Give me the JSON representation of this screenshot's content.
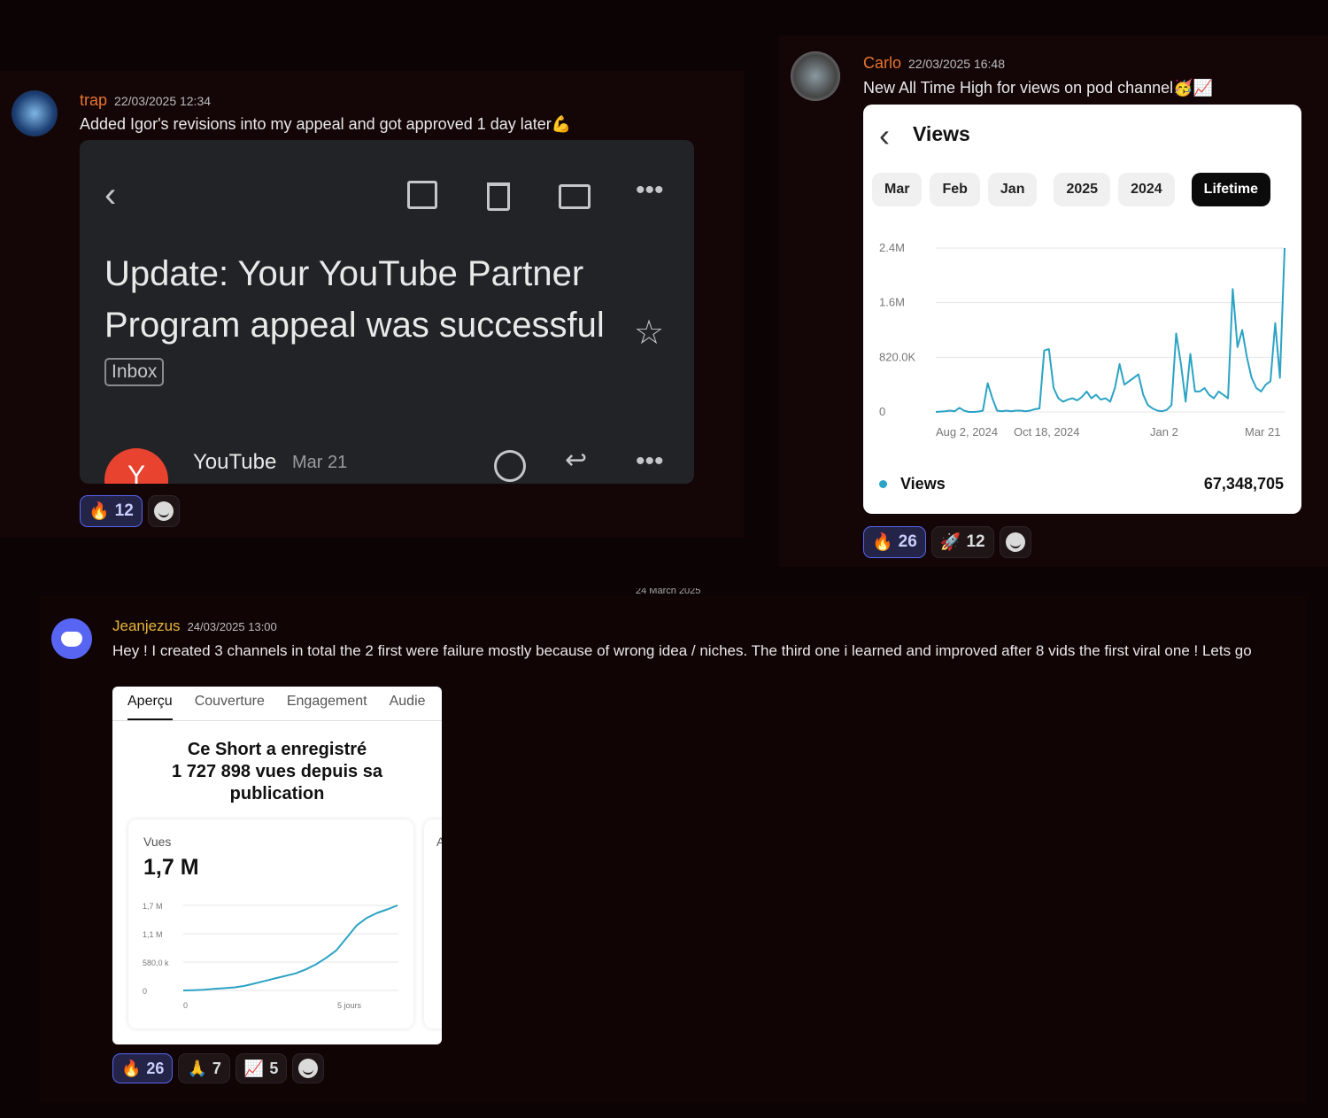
{
  "messages": [
    {
      "user": "trap",
      "timestamp": "22/03/2025 12:34",
      "text": "Added Igor's revisions into my appeal and got approved 1 day later",
      "emoji": "💪",
      "reactions": [
        {
          "emoji": "🔥",
          "count": "12"
        }
      ]
    },
    {
      "user": "Carlo",
      "timestamp": "22/03/2025 16:48",
      "text": "New All Time High for views on pod channel",
      "emoji": "🥳📈",
      "reactions": [
        {
          "emoji": "🔥",
          "count": "26"
        },
        {
          "emoji": "🚀",
          "count": "12"
        }
      ]
    },
    {
      "user": "Jeanjezus",
      "timestamp": "24/03/2025 13:00",
      "text": "Hey ! I created 3 channels in total the 2 first were failure mostly because of wrong idea / niches. The third one i learned and improved after 8 vids the first viral one ! Lets go",
      "reactions": [
        {
          "emoji": "🔥",
          "count": "26"
        },
        {
          "emoji": "🙏",
          "count": "7"
        },
        {
          "emoji": "📈",
          "count": "5"
        }
      ]
    }
  ],
  "divider": "24 March 2025",
  "email": {
    "subject_line1": "Update: Your YouTube Partner",
    "subject_line2": "Program appeal was successful",
    "label": "Inbox",
    "sender": "YouTube",
    "date": "Mar 21",
    "avatar_letter": "Y"
  },
  "views_card": {
    "title": "Views",
    "periods": [
      "Mar",
      "Feb",
      "Jan",
      "2025",
      "2024",
      "Lifetime"
    ],
    "selected": "Lifetime",
    "legend": "Views",
    "total": "67,348,705"
  },
  "short_card": {
    "tabs": [
      "Aperçu",
      "Couverture",
      "Engagement",
      "Audie"
    ],
    "headline1": "Ce Short a enregistré",
    "headline2": "1 727 898 vues depuis sa",
    "headline3": "publication",
    "metric_label": "Vues",
    "metric_value": "1,7 M",
    "side_label": "A"
  },
  "chart_data": [
    {
      "type": "line",
      "title": "Views",
      "series": [
        {
          "name": "Views",
          "values": [
            0,
            5,
            10,
            20,
            10,
            60,
            20,
            0,
            0,
            5,
            20,
            420,
            200,
            20,
            10,
            20,
            10,
            20,
            20,
            10,
            20,
            40,
            50,
            900,
            920,
            350,
            200,
            150,
            180,
            200,
            170,
            220,
            300,
            200,
            250,
            180,
            200,
            150,
            350,
            700,
            400,
            450,
            500,
            550,
            250,
            100,
            50,
            20,
            10,
            30,
            100,
            1150,
            700,
            150,
            850,
            300,
            300,
            350,
            250,
            200,
            300,
            250,
            200,
            1800,
            950,
            1200,
            800,
            500,
            350,
            300,
            400,
            450,
            1300,
            500,
            2400
          ]
        }
      ],
      "y_ticks": [
        "0",
        "820.0K",
        "1.6M",
        "2.4M"
      ],
      "x_ticks": [
        "Aug 2, 2024",
        "Oct 18, 2024",
        "Jan 2",
        "Mar 21"
      ],
      "ylim": [
        0,
        2400000
      ],
      "unit": "thousands"
    },
    {
      "type": "line",
      "title": "Vues",
      "series": [
        {
          "name": "Vues",
          "values": [
            0,
            5,
            15,
            30,
            45,
            60,
            90,
            140,
            190,
            240,
            290,
            340,
            420,
            520,
            650,
            800,
            1050,
            1300,
            1450,
            1550,
            1620,
            1700
          ]
        }
      ],
      "y_ticks": [
        "0",
        "580,0 k",
        "1,1 M",
        "1,7 M"
      ],
      "x_ticks": [
        "0",
        "5 jours"
      ],
      "ylim": [
        0,
        1700000
      ],
      "unit": "thousands"
    }
  ],
  "colors": {
    "trap": "#e8742c",
    "carlo": "#e8742c",
    "jeanjezus": "#e6b73a",
    "line": "#2ba3c4",
    "discord": "#5865f2"
  }
}
